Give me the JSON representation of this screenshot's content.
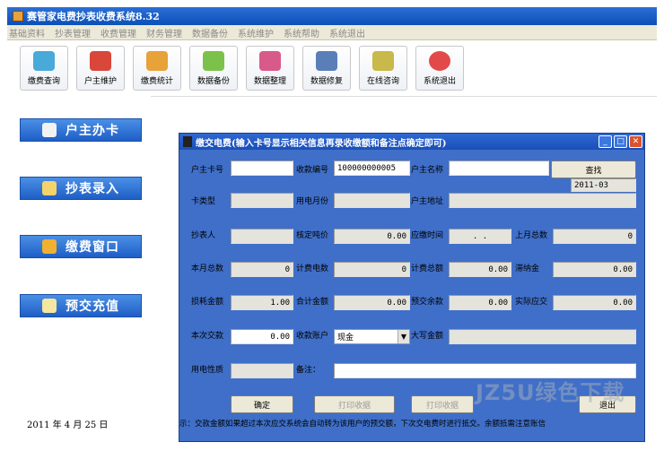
{
  "window": {
    "title": "赛管家电费抄表收费系统8.32"
  },
  "menu": [
    "基础资料",
    "抄表管理",
    "收费管理",
    "财务管理",
    "数据备份",
    "系统维护",
    "系统帮助",
    "系统退出"
  ],
  "toolbar": [
    {
      "label": "缴费查询",
      "icon": "search-icon",
      "color": "#49a9d8"
    },
    {
      "label": "户主维护",
      "icon": "users-icon",
      "color": "#d8473a"
    },
    {
      "label": "缴费统计",
      "icon": "stats-icon",
      "color": "#e8a23a"
    },
    {
      "label": "数据备份",
      "icon": "backup-icon",
      "color": "#7cc24a"
    },
    {
      "label": "数据整理",
      "icon": "organize-icon",
      "color": "#d85a8a"
    },
    {
      "label": "数据修复",
      "icon": "repair-icon",
      "color": "#5a7fb8"
    },
    {
      "label": "在线咨询",
      "icon": "consult-icon",
      "color": "#c9b84a"
    },
    {
      "label": "系统退出",
      "icon": "exit-icon",
      "color": "#e24a4a"
    }
  ],
  "sidebar": [
    {
      "label": "户主办卡",
      "icon": "person-card-icon",
      "color": "#f2f2f2"
    },
    {
      "label": "抄表录入",
      "icon": "book-icon",
      "color": "#f5d36b"
    },
    {
      "label": "缴费窗口",
      "icon": "coins-icon",
      "color": "#f0b030"
    },
    {
      "label": "预交充值",
      "icon": "pen-icon",
      "color": "#f5e6a0"
    }
  ],
  "date_label": "2011 年   4 月 25 日",
  "dialog": {
    "title": "缴交电费(输入卡号显示相关信息再录收缴额和备注点确定即可)",
    "labels": {
      "card_no": "户主卡号",
      "receipt_no": "收款编号",
      "owner_name": "户主名称",
      "card_type": "卡类型",
      "usage_month": "用电月份",
      "owner_addr": "户主地址",
      "reader": "抄表人",
      "unit_price": "核定吨价",
      "due_time": "应缴时间",
      "last_total": "上月总数",
      "this_total": "本月总数",
      "billed_kwh": "计费电数",
      "billed_total": "计费总额",
      "late_fee": "滞纳金",
      "loss_amount": "损耗金额",
      "sum_amount": "合计金额",
      "prepaid_bal": "预交余款",
      "actual_due": "实际应交",
      "pay_amount": "本次交款",
      "pay_account": "收款账户",
      "amount_words": "大写金额",
      "usage_type": "用电性质",
      "remark": "备注："
    },
    "values": {
      "receipt_no": "100000000005",
      "month_value": "2011-03",
      "due_time": ".  .",
      "last_total": "0",
      "this_total": "0",
      "unit_price": "0.00",
      "billed_kwh": "0",
      "billed_total": "0.00",
      "late_fee": "0.00",
      "loss_amount": "1.00",
      "sum_amount": "0.00",
      "prepaid_bal": "0.00",
      "actual_due": "0.00",
      "pay_amount": "0.00",
      "pay_account": "现金"
    },
    "buttons": {
      "find": "查找",
      "ok": "确定",
      "print1": "打印收据",
      "print2": "打印收据",
      "exit": "退出"
    },
    "hint": "示：交款金额如果超过本次应交系统会自动转为该用户的预交额，下次交电费时进行抵交。余额抵需注意账信"
  },
  "watermark": "JZ5U绿色下载"
}
